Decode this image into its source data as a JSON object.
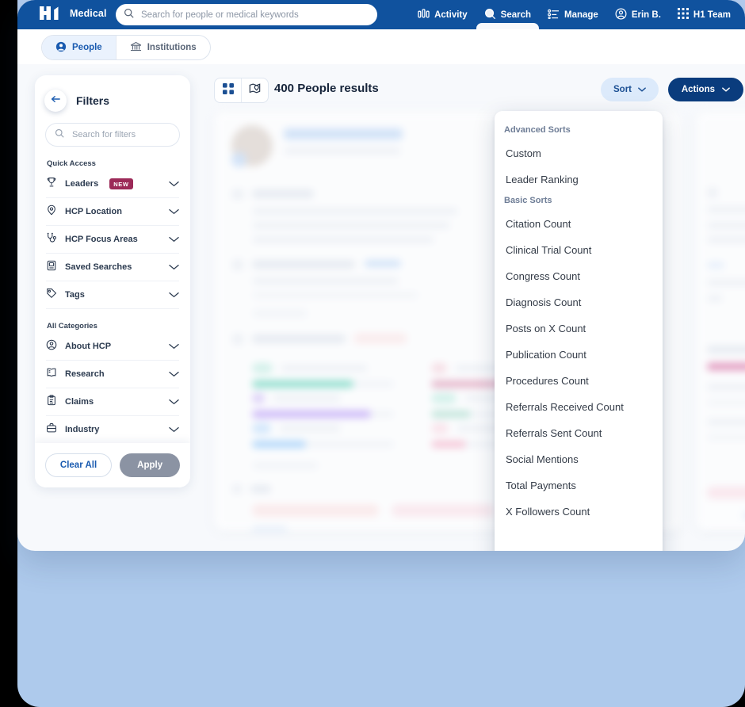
{
  "header": {
    "brand_name": "Medical",
    "brand_logo": "h1-logo",
    "search_placeholder": "Search for people or medical keywords",
    "search_value": "",
    "nav": [
      {
        "label": "Activity",
        "icon": "activity-bars-icon",
        "active": false
      },
      {
        "label": "Search",
        "icon": "search-magnifier-icon",
        "active": true
      },
      {
        "label": "Manage",
        "icon": "list-settings-icon",
        "active": false
      },
      {
        "label": "Erin B.",
        "icon": "user-circle-icon",
        "active": false
      },
      {
        "label": "H1 Team",
        "icon": "grid-dots-icon",
        "active": false
      }
    ]
  },
  "tabs": [
    {
      "label": "People",
      "icon": "person-icon",
      "active": true
    },
    {
      "label": "Institutions",
      "icon": "bank-building-icon",
      "active": false
    }
  ],
  "sidebar": {
    "title": "Filters",
    "back_icon": "arrow-left-icon",
    "search_placeholder": "Search for filters",
    "search_value": "",
    "quick_access_title": "Quick Access",
    "quick_access": [
      {
        "label": "Leaders",
        "icon": "trophy-icon",
        "badge": "NEW"
      },
      {
        "label": "HCP Location",
        "icon": "location-pin-icon",
        "badge": ""
      },
      {
        "label": "HCP Focus Areas",
        "icon": "stethoscope-icon",
        "badge": ""
      },
      {
        "label": "Saved Searches",
        "icon": "saved-book-icon",
        "badge": ""
      },
      {
        "label": "Tags",
        "icon": "tag-icon",
        "badge": ""
      }
    ],
    "all_categories_title": "All Categories",
    "all_categories": [
      {
        "label": "About HCP",
        "icon": "user-circle-icon",
        "badge": ""
      },
      {
        "label": "Research",
        "icon": "open-book-icon",
        "badge": ""
      },
      {
        "label": "Claims",
        "icon": "clipboard-icon",
        "badge": ""
      },
      {
        "label": "Industry",
        "icon": "briefcase-icon",
        "badge": ""
      }
    ],
    "clear_all_label": "Clear All",
    "apply_label": "Apply"
  },
  "results": {
    "count_label": "400 People results",
    "view_grid_icon": "grid-view-icon",
    "view_map_icon": "map-view-icon",
    "sort_label": "Sort",
    "actions_label": "Actions",
    "chevron_icon": "chevron-down-icon"
  },
  "sort_menu": {
    "sections": [
      {
        "title": "Advanced Sorts",
        "items": [
          "Custom",
          "Leader Ranking"
        ]
      },
      {
        "title": "Basic Sorts",
        "items": [
          "Citation Count",
          "Clinical Trial Count",
          "Congress Count",
          "Diagnosis Count",
          "Posts on X Count",
          "Publication Count",
          "Procedures Count",
          "Referrals Received Count",
          "Referrals Sent Count",
          "Social Mentions",
          "Total Payments",
          "X Followers Count"
        ]
      }
    ]
  },
  "colors": {
    "header_blue": "#10529E",
    "actions_navy": "#0A3C7D",
    "sort_light_blue": "#DCEAFB",
    "badge_magenta": "#9C2A58",
    "page_backdrop": "#AECAEC",
    "apply_gray": "#8B93A3"
  }
}
